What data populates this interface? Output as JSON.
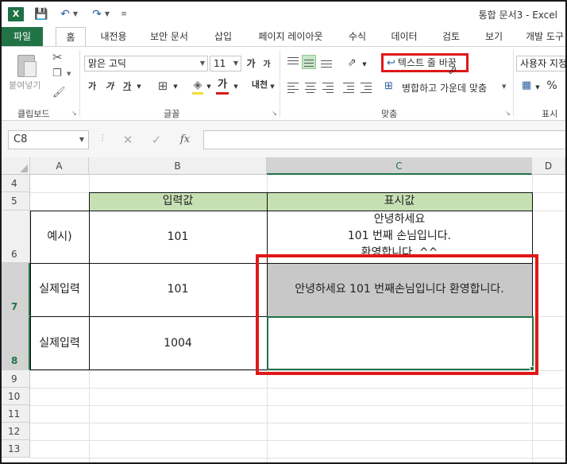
{
  "window": {
    "app_logo": "X",
    "title": "통합 문서3 - Excel",
    "quick_access": {
      "save_icon": "save-icon",
      "undo_icon": "undo-icon",
      "redo_icon": "redo-icon"
    }
  },
  "ribbon_tabs": [
    "파일",
    "홈",
    "내전용",
    "보안 문서",
    "삽입",
    "페이지 레이아웃",
    "수식",
    "데이터",
    "검토",
    "보기",
    "개발 도구"
  ],
  "active_tab": "홈",
  "ribbon": {
    "clipboard": {
      "label": "클립보드",
      "paste_label": "붙여넣기"
    },
    "font": {
      "label": "글꼴",
      "font_name": "맑은 고딕",
      "font_size": "11",
      "grow_label": "가",
      "shrink_label": "가",
      "bold_label": "가",
      "italic_label": "가",
      "underline_label": "가",
      "font_color_label": "가",
      "phonetic_label": "내천",
      "fill_color": "#f4dc3a",
      "font_color": "#d61b1b"
    },
    "alignment": {
      "label": "맞춤",
      "wrap_text_label": "텍스트 줄 바꿈",
      "merge_center_label": "병합하고 가운데 맞춤"
    },
    "number": {
      "label": "표시 형식",
      "format": "사용자 지정",
      "percent_label": "%"
    }
  },
  "formula_bar": {
    "name_box": "C8",
    "fx_label": "fx",
    "cancel_label": "✕",
    "enter_label": "✓",
    "value": ""
  },
  "sheet": {
    "columns": [
      "A",
      "B",
      "C",
      "D"
    ],
    "selected_column": "C",
    "rows": [
      "4",
      "5",
      "6",
      "7",
      "8",
      "9",
      "10",
      "11",
      "12",
      "13"
    ],
    "selected_rows": [
      "7",
      "8"
    ],
    "table": {
      "header_b": "입력값",
      "header_c": "표시값",
      "row6_a": "예시)",
      "row6_b": "101",
      "row6_c_line1": "안녕하세요",
      "row6_c_line2": "101 번째 손님입니다.",
      "row6_c_line3": "환영합니다. ^^",
      "row7_a": "실제입력",
      "row7_b": "101",
      "row7_c": "안녕하세요 101 번째손님입니다 환영합니다.",
      "row8_a": "실제입력",
      "row8_b": "1004",
      "row8_c": ""
    },
    "header_fill": "#c6e0b4",
    "highlight_color": "#e01818",
    "accent": "#217346"
  }
}
